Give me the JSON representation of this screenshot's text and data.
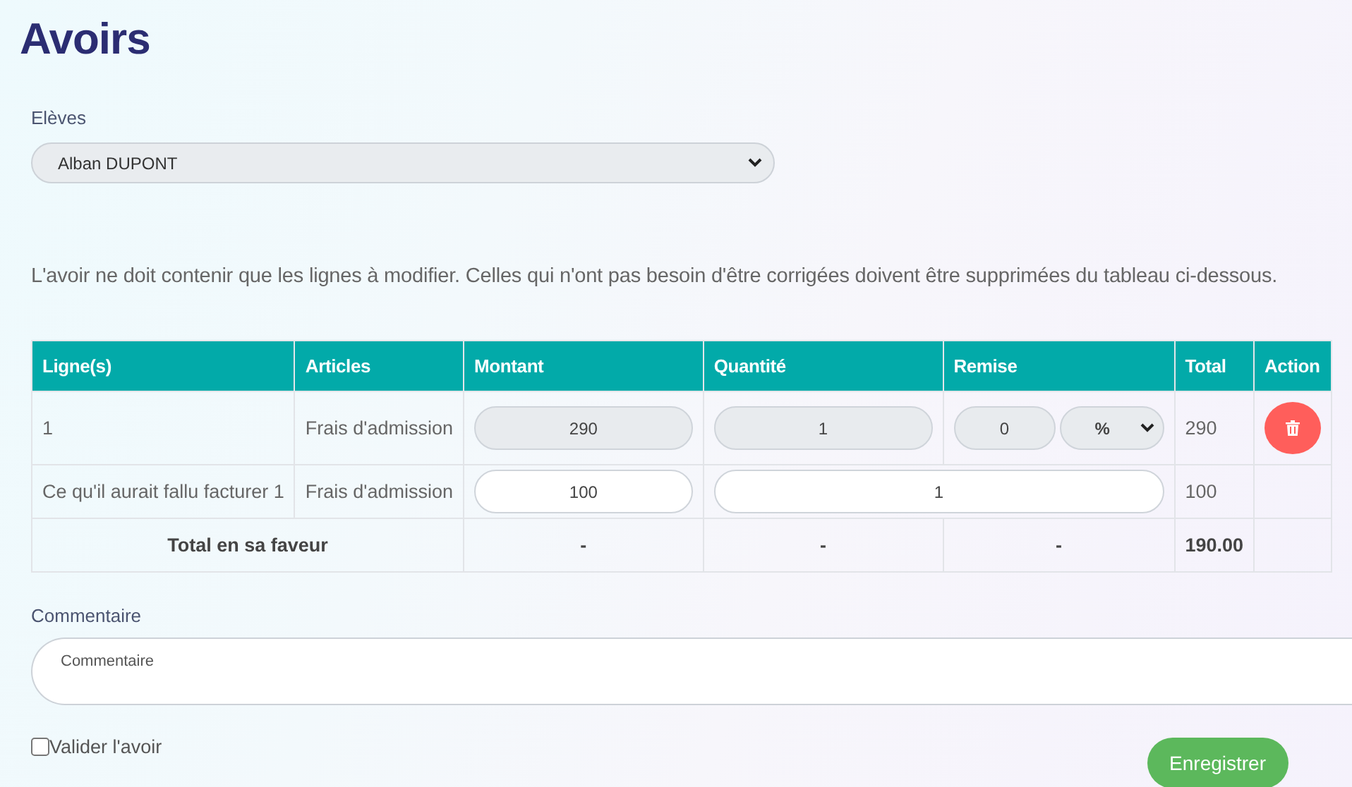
{
  "title": "Avoirs",
  "student": {
    "label": "Elèves",
    "value": "Alban DUPONT"
  },
  "notice": "L'avoir ne doit contenir que les lignes à modifier. Celles qui n'ont pas besoin d'être corrigées doivent être supprimées du tableau ci-dessous.",
  "table": {
    "columns": [
      "Ligne(s)",
      "Articles",
      "Montant",
      "Quantité",
      "Remise",
      "Total",
      "Action"
    ],
    "rows": [
      {
        "line": "1",
        "article": "Frais d'admission",
        "amount": {
          "value": "290",
          "disabled": true
        },
        "quantity": {
          "value": "1",
          "disabled": true
        },
        "discount": {
          "value": "0",
          "unit": "%",
          "disabled": true
        },
        "total": "290",
        "deletable": true
      },
      {
        "line": "Ce qu'il aurait fallu facturer 1",
        "article": "Frais d'admission",
        "amount": {
          "value": "100",
          "disabled": false
        },
        "quantity": {
          "value": "1",
          "disabled": false
        },
        "total": "100",
        "deletable": false
      }
    ],
    "summary": {
      "label": "Total en sa faveur",
      "amount": "-",
      "quantity": "-",
      "discount": "-",
      "total": "190.00"
    }
  },
  "comment": {
    "label": "Commentaire",
    "placeholder": "Commentaire"
  },
  "validate": {
    "label": "Valider l'avoir",
    "checked": false
  },
  "save_button": "Enregistrer"
}
